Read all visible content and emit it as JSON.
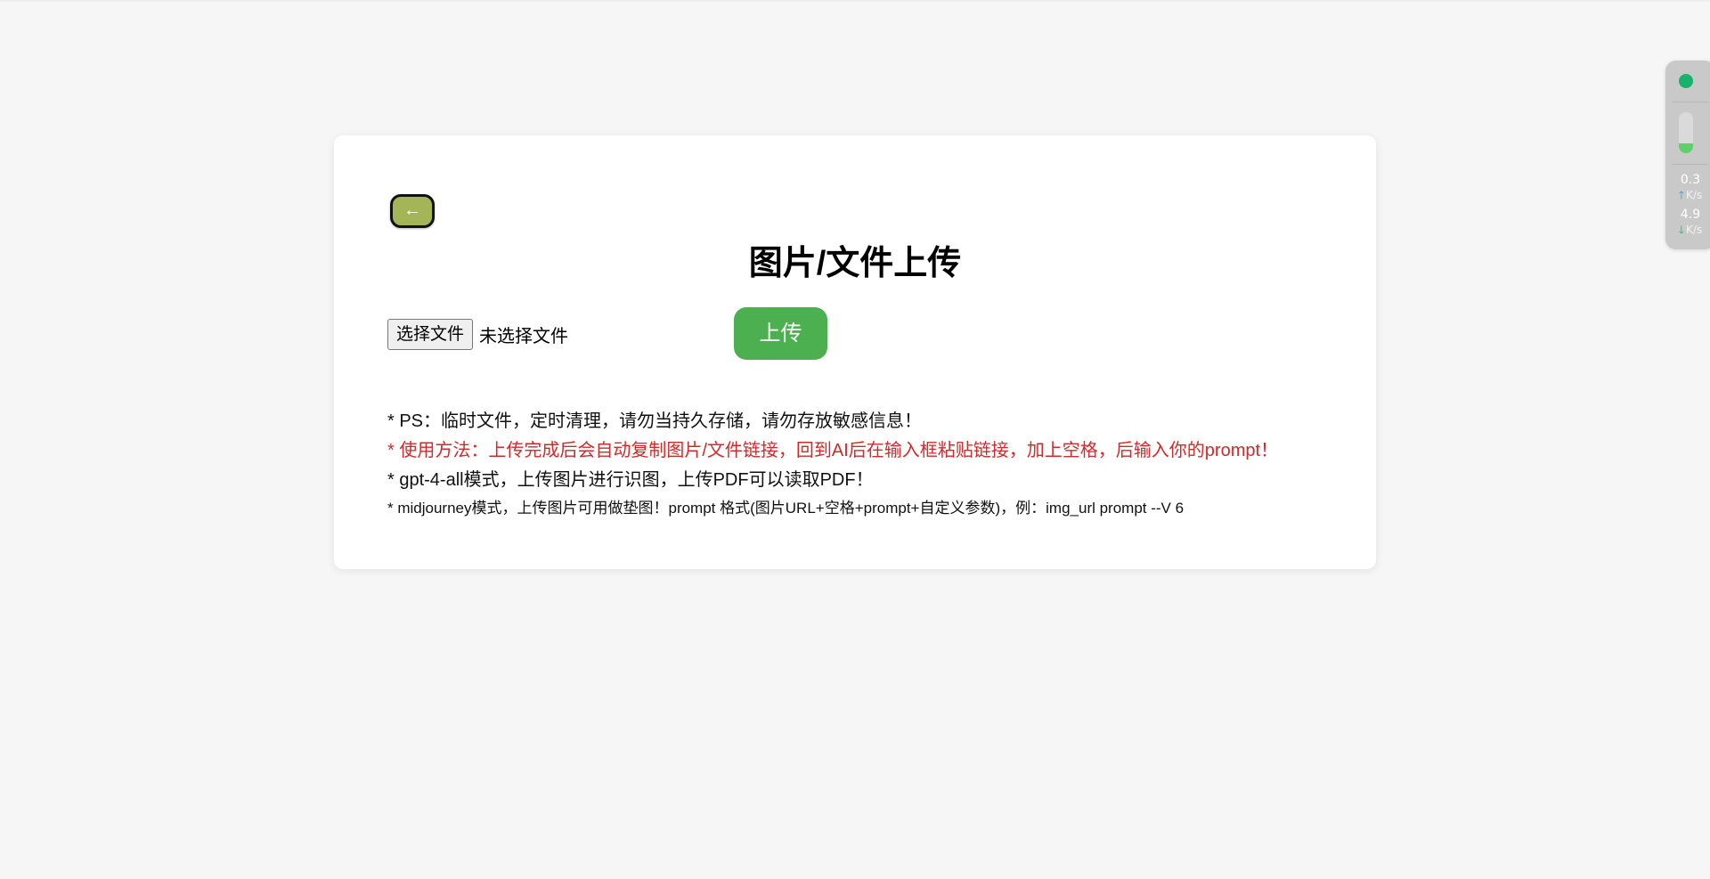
{
  "card": {
    "back_label": "←",
    "title": "图片/文件上传",
    "file_choose_label": "选择文件",
    "file_status": "未选择文件",
    "upload_label": "上传",
    "notes": [
      "* PS：临时文件，定时清理，请勿当持久存储，请勿存放敏感信息！",
      "* 使用方法：上传完成后会自动复制图片/文件链接，回到AI后在输入框粘贴链接，加上空格，后输入你的prompt！",
      "* gpt-4-all模式，上传图片进行识图，上传PDF可以读取PDF！",
      "* midjourney模式，上传图片可用做垫图！prompt 格式(图片URL+空格+prompt+自定义参数)，例：img_url prompt --V 6"
    ]
  },
  "colors": {
    "back_button": "#a3b556",
    "upload_button": "#4caf50",
    "warning_text": "#d12a2a"
  },
  "widget": {
    "upload_speed": "0.3",
    "upload_unit": "K/s",
    "download_speed": "4.9",
    "download_unit": "K/s",
    "level_fraction": 0.25
  }
}
